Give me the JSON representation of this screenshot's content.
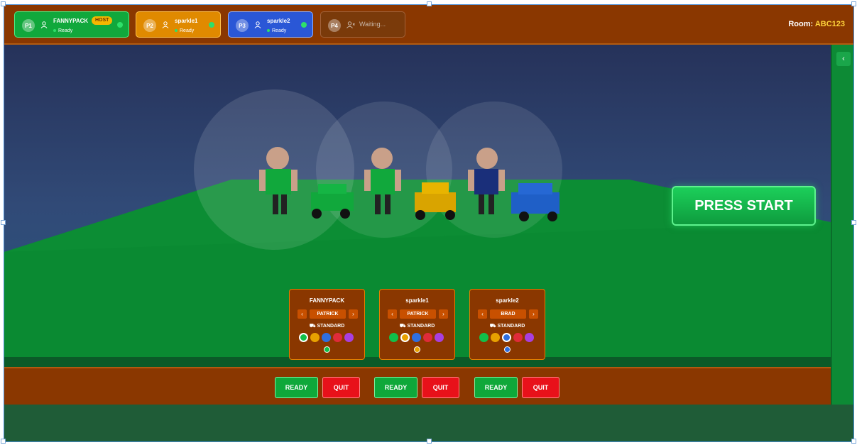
{
  "players": [
    {
      "slot": "P1",
      "name": "FANNYPACK",
      "status": "Ready",
      "host_label": "HOST",
      "color": "#11a83c",
      "border": "#4bef86"
    },
    {
      "slot": "P2",
      "name": "sparkle1",
      "status": "Ready",
      "color": "#e08a00",
      "border": "#ffc34d"
    },
    {
      "slot": "P3",
      "name": "sparkle2",
      "status": "Ready",
      "color": "#2a57d6",
      "border": "#8fb0ff"
    },
    {
      "slot": "P4",
      "name": "Waiting...",
      "status": "",
      "color": "#7a3a0a",
      "border": "#a0623a"
    }
  ],
  "room": {
    "label": "Room:",
    "code": "ABC123"
  },
  "press_start_label": "PRESS START",
  "side_toggle_icon": "chevron-left-icon",
  "selection_cards": [
    {
      "player": "FANNYPACK",
      "character": "PATRICK",
      "vehicle": "STANDARD",
      "selected_color": "#11c04a"
    },
    {
      "player": "sparkle1",
      "character": "PATRICK",
      "vehicle": "STANDARD",
      "selected_color": "#e8a100"
    },
    {
      "player": "sparkle2",
      "character": "BRAD",
      "vehicle": "STANDARD",
      "selected_color": "#2f6fe0"
    }
  ],
  "color_options": [
    "#11c04a",
    "#e8a100",
    "#2f6fe0",
    "#e02b3a",
    "#a83fe0"
  ],
  "buttons": {
    "ready": "READY",
    "quit": "QUIT"
  }
}
